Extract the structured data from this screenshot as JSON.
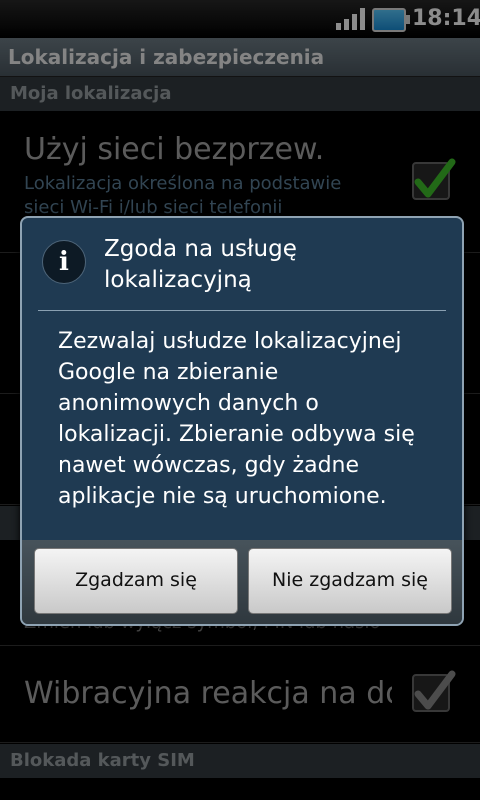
{
  "status": {
    "time": "18:14"
  },
  "titlebar": {
    "title": "Lokalizacja i zabezpieczenia"
  },
  "sections": {
    "my_location": "Moja lokalizacja",
    "sim_lock": "Blokada karty SIM"
  },
  "rows": {
    "wireless": {
      "title": "Użyj sieci bezprzew.",
      "subtitle": "Lokalizacja określona na podstawie sieci Wi-Fi i/lub sieci telefonii",
      "checked": true
    },
    "hidden_sub": "Zmień lub wyłącz symbol, PIN lub hasło",
    "haptic": {
      "title": "Wibracyjna reakcja na do",
      "checked": true
    }
  },
  "dialog": {
    "icon": "info-icon",
    "title": "Zgoda na usługę lokalizacyjną",
    "message": "Zezwalaj usłudze lokalizacyjnej Google na zbieranie anonimowych danych o lokalizacji. Zbieranie odbywa się nawet wówczas, gdy żadne aplikacje nie są uruchomione.",
    "agree_label": "Zgadzam się",
    "disagree_label": "Nie zgadzam się"
  },
  "colors": {
    "dialog_bg": "#1f3a52",
    "accent_check": "#3fbf2a"
  }
}
